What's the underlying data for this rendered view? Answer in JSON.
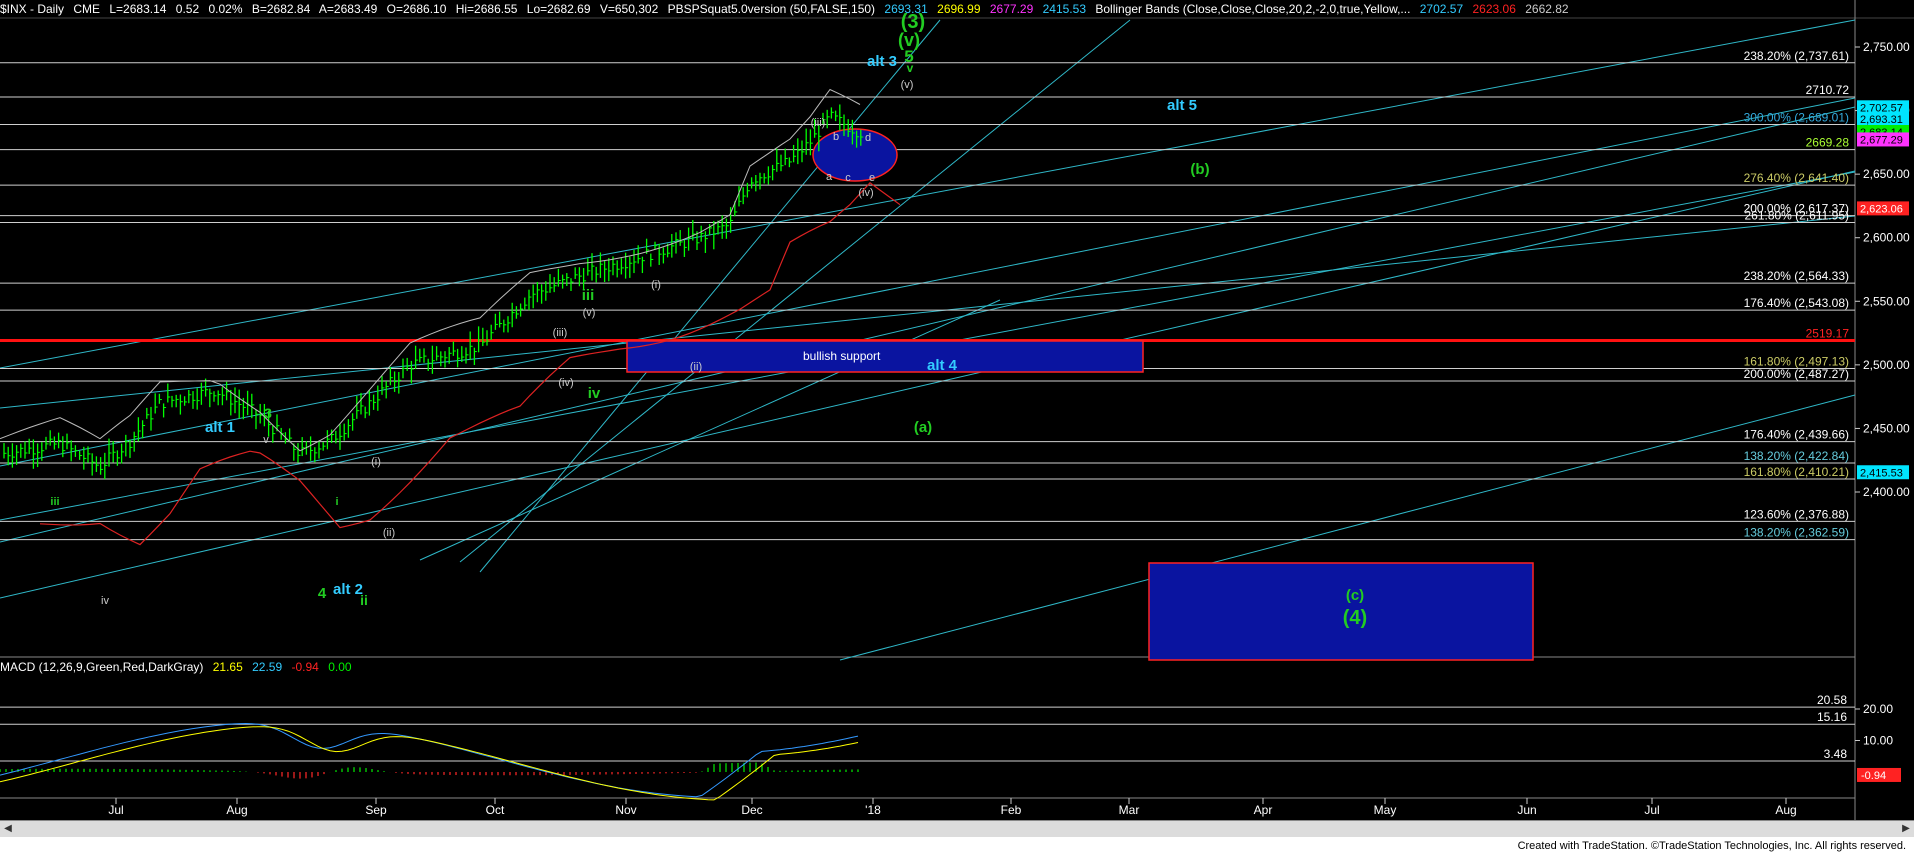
{
  "header": {
    "symbol": "$INX - Daily",
    "exchange": "CME",
    "last": "L=2683.14",
    "change": "0.52",
    "pct": "0.02%",
    "bid": "B=2682.84",
    "ask": "A=2683.49",
    "open": "O=2686.10",
    "high": "Hi=2686.55",
    "low": "Lo=2682.69",
    "volume": "V=650,302",
    "study": "PBSPSquat5.0version (50,FALSE,150)",
    "study_v1": "2693.31",
    "study_v2": "2696.99",
    "study_v3": "2677.29",
    "study_v4": "2415.53",
    "bb": "Bollinger Bands (Close,Close,Close,20,2,-2,0,true,Yellow,...",
    "bb_v1": "2702.57",
    "bb_v2": "2623.06",
    "bb_v3": "2662.82"
  },
  "macd_header": {
    "label": "MACD (12,26,9,Green,Red,DarkGray)",
    "v1": "21.65",
    "v2": "22.59",
    "v3": "-0.94",
    "v4": "0.00"
  },
  "colors": {
    "background": "#000000",
    "price_bar": "#00ff00",
    "trendline": "#33ccdd",
    "fib_line": "#ffffff",
    "support_line": "#ff0000",
    "box_fill": "#0a14a0",
    "bb_upper": "#ffff00",
    "label_green": "#22cc22",
    "label_cyan": "#33ccff",
    "macd_line": "#3399ff",
    "macd_signal": "#ffff00"
  },
  "footer": {
    "credit": "Created with TradeStation. ©TradeStation Technologies, Inc. All rights reserved."
  },
  "chart_data": {
    "type": "candlestick",
    "x_axis_labels": [
      "Jul",
      "Aug",
      "Sep",
      "Oct",
      "Nov",
      "Dec",
      "'18",
      "Feb",
      "Mar",
      "Apr",
      "May",
      "Jun",
      "Jul",
      "Aug"
    ],
    "price_axis_ticks": [
      "2,750.00",
      "2,700.00",
      "2,650.00",
      "2,600.00",
      "2,550.00",
      "2,500.00",
      "2,450.00",
      "2,400.00"
    ],
    "macd_axis_ticks": [
      "20.00",
      "10.00"
    ],
    "horizontal_levels": [
      {
        "label": "238.20% (2,737.61)",
        "price": 2737.61,
        "color": "#ffffff"
      },
      {
        "label": "2710.72",
        "price": 2710.72,
        "color": "#ffffff"
      },
      {
        "label": "300.00% (2,689.01)",
        "price": 2689.01,
        "color": "#33aadd"
      },
      {
        "label": "2669.28",
        "price": 2669.28,
        "color": "#aaff33"
      },
      {
        "label": "276.40% (2,641.40)",
        "price": 2641.4,
        "color": "#cccc66"
      },
      {
        "label": "200.00% (2,617.37)",
        "price": 2617.37,
        "color": "#ffffff"
      },
      {
        "label": "261.80% (2,611.95)",
        "price": 2611.95,
        "color": "#ffffff"
      },
      {
        "label": "238.20% (2,564.33)",
        "price": 2564.33,
        "color": "#ffffff"
      },
      {
        "label": "176.40% (2,543.08)",
        "price": 2543.08,
        "color": "#ffffff"
      },
      {
        "label": "2519.17",
        "price": 2519.17,
        "color": "#ff2222"
      },
      {
        "label": "161.80% (2,497.13)",
        "price": 2497.13,
        "color": "#cccc66"
      },
      {
        "label": "200.00% (2,487.27)",
        "price": 2487.27,
        "color": "#ffffff"
      },
      {
        "label": "176.40% (2,439.66)",
        "price": 2439.66,
        "color": "#ffffff"
      },
      {
        "label": "138.20% (2,422.84)",
        "price": 2422.84,
        "color": "#66ccdd"
      },
      {
        "label": "161.80% (2,410.21)",
        "price": 2410.21,
        "color": "#cccc66"
      },
      {
        "label": "123.60% (2,376.88)",
        "price": 2376.88,
        "color": "#ffffff"
      },
      {
        "label": "138.20% (2,362.59)",
        "price": 2362.59,
        "color": "#66ccdd"
      }
    ],
    "price_badges": [
      {
        "text": "2,702.57",
        "bg": "#00e5ff",
        "fg": "#000"
      },
      {
        "text": "2,693.31",
        "bg": "#00e5ff",
        "fg": "#000"
      },
      {
        "text": "2,683.14",
        "bg": "#00ee00",
        "fg": "#000"
      },
      {
        "text": "2,677.29",
        "bg": "#ff33ff",
        "fg": "#000"
      },
      {
        "text": "2,623.06",
        "bg": "#ff2222",
        "fg": "#fff"
      },
      {
        "text": "2,415.53",
        "bg": "#00e5ff",
        "fg": "#000"
      }
    ],
    "macd_levels": [
      {
        "label": "20.58",
        "value": 20.58
      },
      {
        "label": "15.16",
        "value": 15.16
      },
      {
        "label": "3.48",
        "value": 3.48
      }
    ],
    "macd_badge": {
      "text": "-0.94",
      "bg": "#ff2222",
      "fg": "#fff"
    },
    "zones": [
      {
        "label": "bullish support"
      },
      {
        "label": ""
      }
    ],
    "wave_labels": {
      "green": [
        "(3)",
        "(v)",
        "5",
        "v",
        "(b)",
        "(a)",
        "(c)",
        "(4)",
        "3",
        "iii",
        "iv",
        "4",
        "ii",
        "iii",
        "i"
      ],
      "cyan": [
        "alt 3",
        "alt 5",
        "alt 4",
        "alt 1",
        "alt 2"
      ],
      "white": [
        "(v)",
        "(iii)",
        "b",
        "d",
        "a",
        "c",
        "e",
        "(iv)",
        "(i)",
        "(v)",
        "(iii)",
        "(iv)",
        "(ii)",
        "v",
        "iv",
        "(i)",
        "(ii)"
      ]
    },
    "price_series": {
      "dates": [
        "Jun",
        "Jul",
        "Aug",
        "Sep",
        "Oct",
        "Nov",
        "Dec"
      ],
      "approx_close": [
        2440,
        2420,
        2475,
        2465,
        2520,
        2580,
        2683
      ]
    },
    "ylim": [
      2350,
      2790
    ],
    "grid": false
  }
}
